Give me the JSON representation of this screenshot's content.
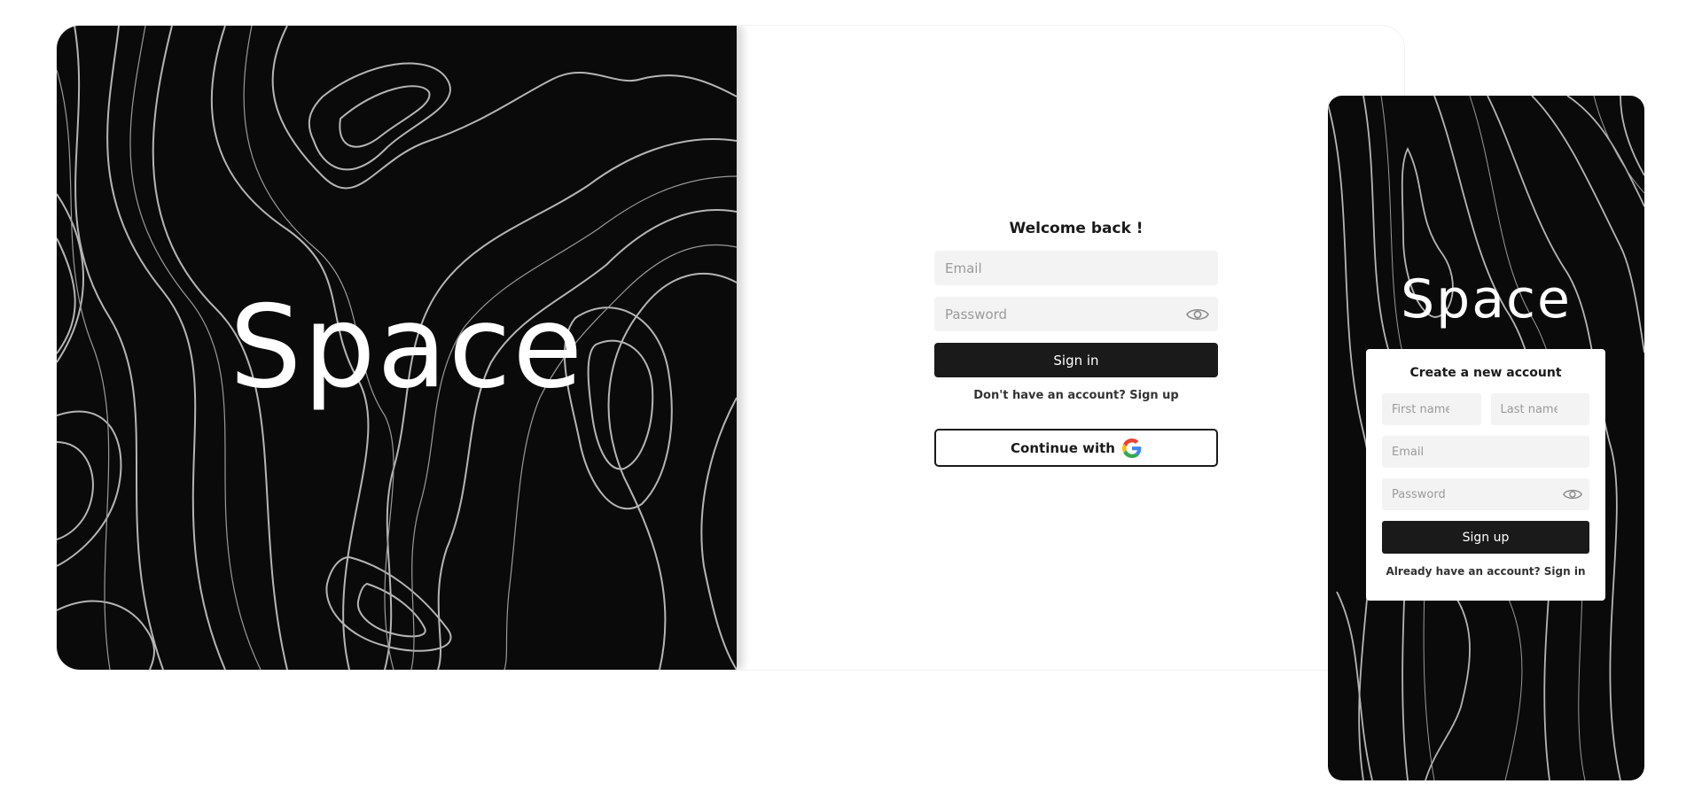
{
  "brand": {
    "name": "Space"
  },
  "login": {
    "title": "Welcome back !",
    "email_placeholder": "Email",
    "password_placeholder": "Password",
    "signin_label": "Sign in",
    "signup_prompt": "Don't have an account? Sign up",
    "google_label": "Continue with"
  },
  "signup": {
    "title": "Create a new account",
    "first_name_placeholder": "First name",
    "last_name_placeholder": "Last name",
    "email_placeholder": "Email",
    "password_placeholder": "Password",
    "signup_label": "Sign up",
    "signin_prompt": "Already have an account? Sign in"
  },
  "icons": {
    "password_toggle": "eye-icon",
    "google": "google-icon"
  },
  "colors": {
    "hero_bg": "#0a0a0a",
    "contour_line": "#b5b5b5",
    "primary_button": "#1a1a1a",
    "input_bg": "#f3f3f3"
  }
}
